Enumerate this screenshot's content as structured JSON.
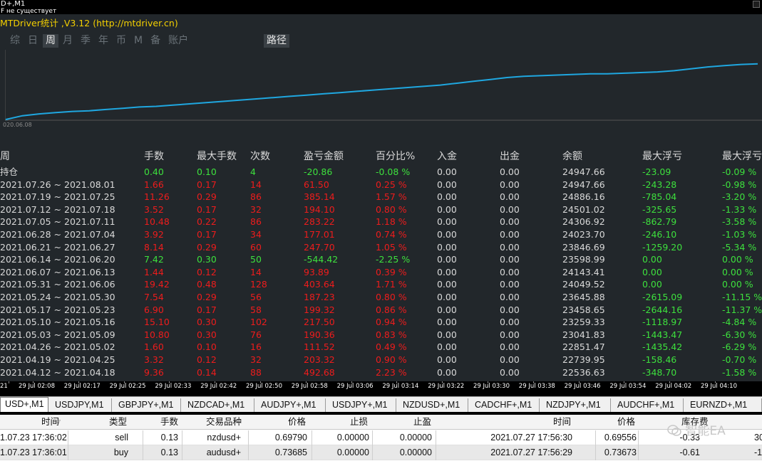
{
  "window": {
    "title": "D+,M1",
    "subtitle": "F не существует"
  },
  "panel": {
    "title": "MTDriver统计 ,V3.12 (http://mtdriver.cn)",
    "tabs": [
      {
        "label": "综",
        "active": false
      },
      {
        "label": "日",
        "active": false
      },
      {
        "label": "周",
        "active": true
      },
      {
        "label": "月",
        "active": false
      },
      {
        "label": "季",
        "active": false
      },
      {
        "label": "年",
        "active": false
      },
      {
        "label": "币",
        "active": false
      },
      {
        "label": "M",
        "active": false
      },
      {
        "label": "备",
        "active": false
      },
      {
        "label": "账户",
        "active": false
      }
    ],
    "path_button": "路径",
    "equity_start_label": "020.06.08"
  },
  "equity_curve": {
    "line_color": "#1fa7e0",
    "values": [
      0.0,
      0.06,
      0.09,
      0.11,
      0.13,
      0.14,
      0.16,
      0.18,
      0.2,
      0.21,
      0.23,
      0.25,
      0.27,
      0.29,
      0.31,
      0.33,
      0.35,
      0.37,
      0.39,
      0.41,
      0.43,
      0.45,
      0.47,
      0.49,
      0.51,
      0.53,
      0.55,
      0.58,
      0.61,
      0.64,
      0.67,
      0.69,
      0.7,
      0.71,
      0.72,
      0.73,
      0.73,
      0.74,
      0.75,
      0.76,
      0.78,
      0.81,
      0.84,
      0.86,
      0.88,
      0.89
    ]
  },
  "stats": {
    "headers": [
      "周",
      "手数",
      "最大手数",
      "次数",
      "盈亏金额",
      "百分比%",
      "入金",
      "出金",
      "余额",
      "最大浮亏",
      "最大浮亏"
    ],
    "rows": [
      {
        "period": "持仓",
        "lots": "0.40",
        "max_lots": "0.10",
        "count": "4",
        "pnl": "-20.86",
        "pct": "-0.08 %",
        "dep": "0.00",
        "wd": "0.00",
        "bal": "24947.66",
        "max_dd": "-23.09",
        "max_dd_pct": "-0.09 %",
        "color": "g"
      },
      {
        "period": "2021.07.26 ~ 2021.08.01",
        "lots": "1.66",
        "max_lots": "0.17",
        "count": "14",
        "pnl": "61.50",
        "pct": "0.25 %",
        "dep": "0.00",
        "wd": "0.00",
        "bal": "24947.66",
        "max_dd": "-243.28",
        "max_dd_pct": "-0.98 %",
        "color": "r"
      },
      {
        "period": "2021.07.19 ~ 2021.07.25",
        "lots": "11.26",
        "max_lots": "0.29",
        "count": "86",
        "pnl": "385.14",
        "pct": "1.57 %",
        "dep": "0.00",
        "wd": "0.00",
        "bal": "24886.16",
        "max_dd": "-785.04",
        "max_dd_pct": "-3.20 %",
        "color": "r"
      },
      {
        "period": "2021.07.12 ~ 2021.07.18",
        "lots": "3.52",
        "max_lots": "0.17",
        "count": "32",
        "pnl": "194.10",
        "pct": "0.80 %",
        "dep": "0.00",
        "wd": "0.00",
        "bal": "24501.02",
        "max_dd": "-325.65",
        "max_dd_pct": "-1.33 %",
        "color": "r"
      },
      {
        "period": "2021.07.05 ~ 2021.07.11",
        "lots": "10.48",
        "max_lots": "0.22",
        "count": "86",
        "pnl": "283.22",
        "pct": "1.18 %",
        "dep": "0.00",
        "wd": "0.00",
        "bal": "24306.92",
        "max_dd": "-862.79",
        "max_dd_pct": "-3.58 %",
        "color": "r"
      },
      {
        "period": "2021.06.28 ~ 2021.07.04",
        "lots": "3.92",
        "max_lots": "0.17",
        "count": "34",
        "pnl": "177.01",
        "pct": "0.74 %",
        "dep": "0.00",
        "wd": "0.00",
        "bal": "24023.70",
        "max_dd": "-246.10",
        "max_dd_pct": "-1.03 %",
        "color": "r"
      },
      {
        "period": "2021.06.21 ~ 2021.06.27",
        "lots": "8.14",
        "max_lots": "0.29",
        "count": "60",
        "pnl": "247.70",
        "pct": "1.05 %",
        "dep": "0.00",
        "wd": "0.00",
        "bal": "23846.69",
        "max_dd": "-1259.20",
        "max_dd_pct": "-5.34 %",
        "color": "r"
      },
      {
        "period": "2021.06.14 ~ 2021.06.20",
        "lots": "7.42",
        "max_lots": "0.30",
        "count": "50",
        "pnl": "-544.42",
        "pct": "-2.25 %",
        "dep": "0.00",
        "wd": "0.00",
        "bal": "23598.99",
        "max_dd": "0.00",
        "max_dd_pct": "0.00 %",
        "color": "g"
      },
      {
        "period": "2021.06.07 ~ 2021.06.13",
        "lots": "1.44",
        "max_lots": "0.12",
        "count": "14",
        "pnl": "93.89",
        "pct": "0.39 %",
        "dep": "0.00",
        "wd": "0.00",
        "bal": "24143.41",
        "max_dd": "0.00",
        "max_dd_pct": "0.00 %",
        "color": "r"
      },
      {
        "period": "2021.05.31 ~ 2021.06.06",
        "lots": "19.42",
        "max_lots": "0.48",
        "count": "128",
        "pnl": "403.64",
        "pct": "1.71 %",
        "dep": "0.00",
        "wd": "0.00",
        "bal": "24049.52",
        "max_dd": "0.00",
        "max_dd_pct": "0.00 %",
        "color": "r"
      },
      {
        "period": "2021.05.24 ~ 2021.05.30",
        "lots": "7.54",
        "max_lots": "0.29",
        "count": "56",
        "pnl": "187.23",
        "pct": "0.80 %",
        "dep": "0.00",
        "wd": "0.00",
        "bal": "23645.88",
        "max_dd": "-2615.09",
        "max_dd_pct": "-11.15 %",
        "color": "r"
      },
      {
        "period": "2021.05.17 ~ 2021.05.23",
        "lots": "6.90",
        "max_lots": "0.17",
        "count": "58",
        "pnl": "199.32",
        "pct": "0.86 %",
        "dep": "0.00",
        "wd": "0.00",
        "bal": "23458.65",
        "max_dd": "-2644.16",
        "max_dd_pct": "-11.37 %",
        "color": "r"
      },
      {
        "period": "2021.05.10 ~ 2021.05.16",
        "lots": "15.10",
        "max_lots": "0.30",
        "count": "102",
        "pnl": "217.50",
        "pct": "0.94 %",
        "dep": "0.00",
        "wd": "0.00",
        "bal": "23259.33",
        "max_dd": "-1118.97",
        "max_dd_pct": "-4.84 %",
        "color": "r"
      },
      {
        "period": "2021.05.03 ~ 2021.05.09",
        "lots": "10.80",
        "max_lots": "0.30",
        "count": "76",
        "pnl": "190.36",
        "pct": "0.83 %",
        "dep": "0.00",
        "wd": "0.00",
        "bal": "23041.83",
        "max_dd": "-1443.47",
        "max_dd_pct": "-6.30 %",
        "color": "r"
      },
      {
        "period": "2021.04.26 ~ 2021.05.02",
        "lots": "1.60",
        "max_lots": "0.10",
        "count": "16",
        "pnl": "111.52",
        "pct": "0.49 %",
        "dep": "0.00",
        "wd": "0.00",
        "bal": "22851.47",
        "max_dd": "-1435.42",
        "max_dd_pct": "-6.29 %",
        "color": "r"
      },
      {
        "period": "2021.04.19 ~ 2021.04.25",
        "lots": "3.32",
        "max_lots": "0.12",
        "count": "32",
        "pnl": "203.32",
        "pct": "0.90 %",
        "dep": "0.00",
        "wd": "0.00",
        "bal": "22739.95",
        "max_dd": "-158.46",
        "max_dd_pct": "-0.70 %",
        "color": "r"
      },
      {
        "period": "2021.04.12 ~ 2021.04.18",
        "lots": "9.36",
        "max_lots": "0.14",
        "count": "88",
        "pnl": "492.68",
        "pct": "2.23 %",
        "dep": "0.00",
        "wd": "0.00",
        "bal": "22536.63",
        "max_dd": "-348.70",
        "max_dd_pct": "-1.58 %",
        "color": "r"
      }
    ]
  },
  "time_axis": [
    "21",
    "29 Jul 02:08",
    "29 Jul 02:17",
    "29 Jul 02:25",
    "29 Jul 02:33",
    "29 Jul 02:42",
    "29 Jul 02:50",
    "29 Jul 02:58",
    "29 Jul 03:06",
    "29 Jul 03:14",
    "29 Jul 03:22",
    "29 Jul 03:30",
    "29 Jul 03:38",
    "29 Jul 03:46",
    "29 Jul 03:54",
    "29 Jul 04:02",
    "29 Jul 04:10"
  ],
  "chart_tabs": [
    {
      "label": "USD+,M1",
      "active": true
    },
    {
      "label": "USDJPY,M1",
      "active": false
    },
    {
      "label": "GBPJPY+,M1",
      "active": false
    },
    {
      "label": "NZDCAD+,M1",
      "active": false
    },
    {
      "label": "AUDJPY+,M1",
      "active": false
    },
    {
      "label": "USDJPY+,M1",
      "active": false
    },
    {
      "label": "NZDUSD+,M1",
      "active": false
    },
    {
      "label": "CADCHF+,M1",
      "active": false
    },
    {
      "label": "NZDJPY+,M1",
      "active": false
    },
    {
      "label": "AUDCHF+,M1",
      "active": false
    },
    {
      "label": "EURNZD+,M1",
      "active": false
    }
  ],
  "terminal": {
    "headers": {
      "time": "时间",
      "type": "类型",
      "lots": "手数",
      "symbol": "交易品种",
      "price": "价格",
      "sl": "止损",
      "tp": "止盈",
      "time2": "时间",
      "price2": "价格",
      "swap": "库存费"
    },
    "rows": [
      {
        "time": "1.07.23 17:36:02",
        "type": "sell",
        "lots": "0.13",
        "symbol": "nzdusd+",
        "price": "0.69790",
        "sl": "0.00000",
        "tp": "0.00000",
        "time2": "2021.07.27 17:56:30",
        "price2": "0.69556",
        "swap": "-0.33",
        "extra": "30"
      },
      {
        "time": "1.07.23 17:36:01",
        "type": "buy",
        "lots": "0.13",
        "symbol": "audusd+",
        "price": "0.73685",
        "sl": "0.00000",
        "tp": "0.00000",
        "time2": "2021.07.27 17:56:29",
        "price2": "0.73673",
        "swap": "-0.61",
        "extra": "-1"
      }
    ]
  },
  "watermark": "智能EA"
}
